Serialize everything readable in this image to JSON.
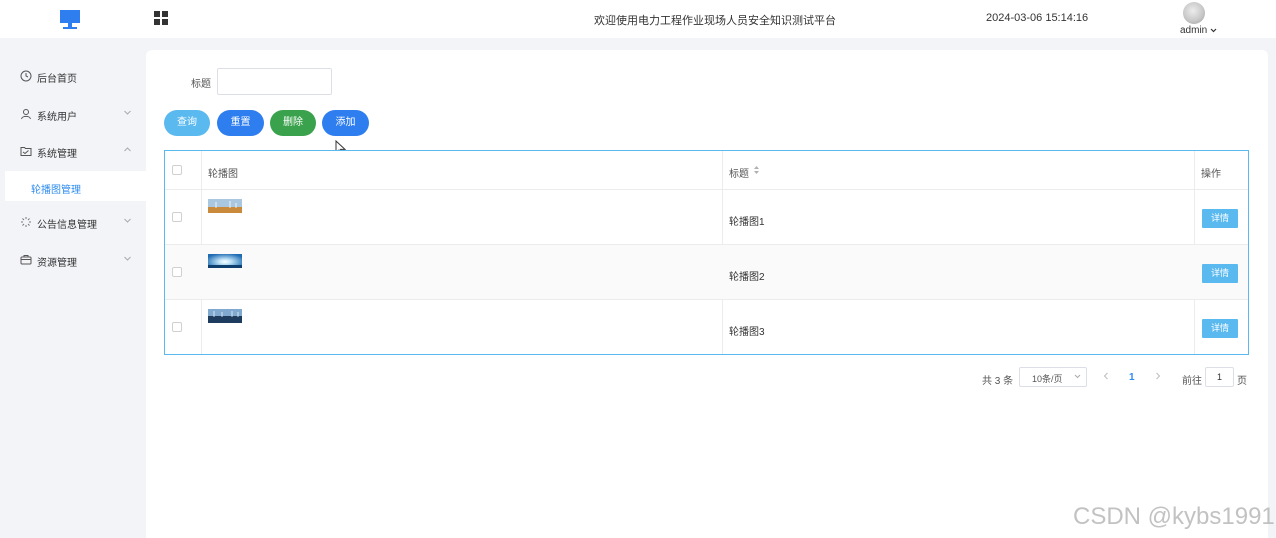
{
  "header": {
    "site_title": "欢迎使用电力工程作业现场人员安全知识测试平台",
    "datetime": "2024-03-06 15:14:16",
    "user": "admin"
  },
  "sidebar": {
    "items": [
      {
        "label": "后台首页",
        "icon": "clock-icon",
        "expandable": false
      },
      {
        "label": "系统用户",
        "icon": "user-icon",
        "expandable": true,
        "expanded": false
      },
      {
        "label": "系统管理",
        "icon": "folder-icon",
        "expandable": true,
        "expanded": true
      },
      {
        "label": "公告信息管理",
        "icon": "loading-icon",
        "expandable": true,
        "expanded": false
      },
      {
        "label": "资源管理",
        "icon": "box-icon",
        "expandable": true,
        "expanded": false
      }
    ],
    "active_sub_item": "轮播图管理"
  },
  "filter": {
    "title_label": "标题",
    "title_value": ""
  },
  "toolbar": {
    "query_label": "查询",
    "reset_label": "重置",
    "delete_label": "删除",
    "add_label": "添加"
  },
  "table": {
    "headers": [
      "轮播图",
      "标题",
      "操作"
    ],
    "rows": [
      {
        "title": "轮播图1",
        "action": "详情",
        "thumbnail": "wind-farm-field"
      },
      {
        "title": "轮播图2",
        "action": "详情",
        "thumbnail": "sky-sunburst"
      },
      {
        "title": "轮播图3",
        "action": "详情",
        "thumbnail": "wind-turbines-sea"
      }
    ]
  },
  "pagination": {
    "total_text": "共 3 条",
    "page_size": "10条/页",
    "current_page": "1",
    "goto_label": "前往",
    "goto_value": "1",
    "page_suffix": "页"
  },
  "watermark": "CSDN @kybs1991",
  "colors": {
    "accent_blue": "#2e7ef0",
    "light_blue": "#5ab9ef",
    "green": "#3aa24c",
    "active_text": "#2d8cf0"
  }
}
